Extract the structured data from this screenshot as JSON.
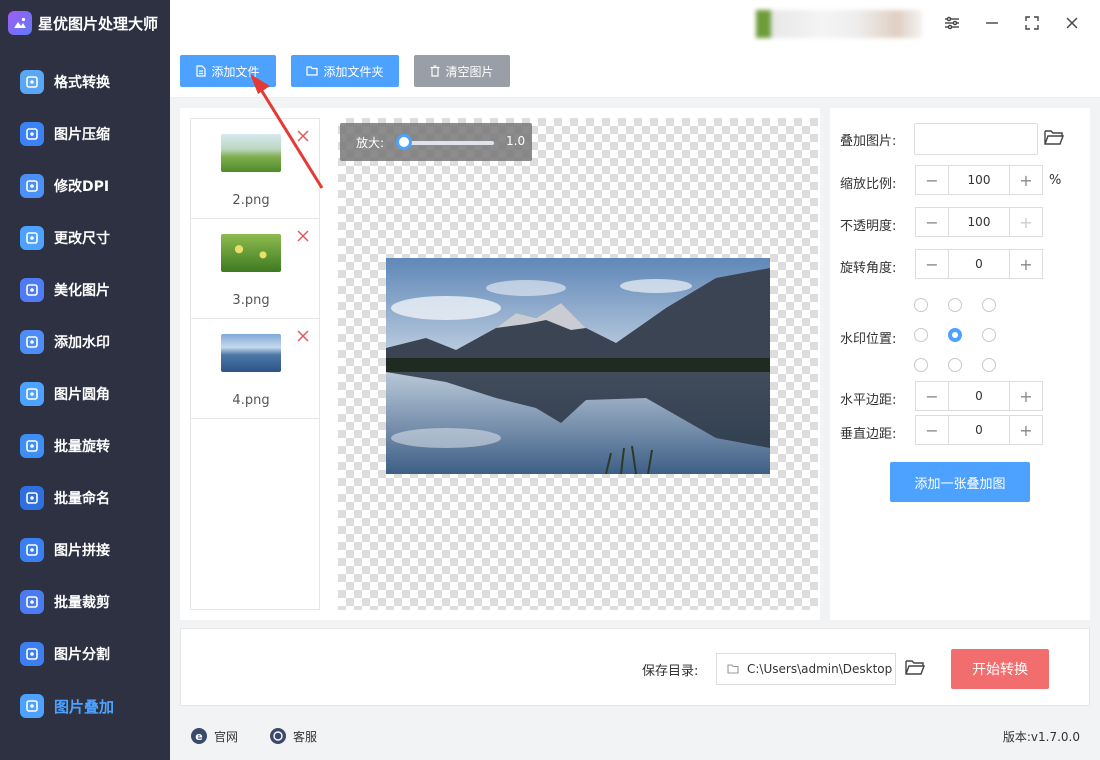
{
  "app": {
    "title": "星优图片处理大师"
  },
  "sidebar": {
    "items": [
      {
        "label": "格式转换",
        "icon": "image-convert-icon",
        "color": "#5aa7f5"
      },
      {
        "label": "图片压缩",
        "icon": "image-compress-icon",
        "color": "#3b82f6"
      },
      {
        "label": "修改DPI",
        "icon": "dpi-icon",
        "color": "#4c8ff5"
      },
      {
        "label": "更改尺寸",
        "icon": "resize-icon",
        "color": "#4ea2ff"
      },
      {
        "label": "美化图片",
        "icon": "beautify-icon",
        "color": "#4f7cf5"
      },
      {
        "label": "添加水印",
        "icon": "watermark-icon",
        "color": "#4e8df5"
      },
      {
        "label": "图片圆角",
        "icon": "round-corner-icon",
        "color": "#4ea2ff"
      },
      {
        "label": "批量旋转",
        "icon": "rotate-icon",
        "color": "#3d8ef5"
      },
      {
        "label": "批量命名",
        "icon": "rename-icon",
        "color": "#2f6fe0"
      },
      {
        "label": "图片拼接",
        "icon": "stitch-icon",
        "color": "#3a7ff0"
      },
      {
        "label": "批量裁剪",
        "icon": "crop-icon",
        "color": "#4a7cf0"
      },
      {
        "label": "图片分割",
        "icon": "split-icon",
        "color": "#3d7ef2"
      },
      {
        "label": "图片叠加",
        "icon": "overlay-layers-icon",
        "color": "#4ea2ff",
        "active": true
      }
    ]
  },
  "toolbar": {
    "add_file": "添加文件",
    "add_folder": "添加文件夹",
    "clear_images": "清空图片"
  },
  "files": [
    {
      "name": "2.png",
      "thumb": "meadow"
    },
    {
      "name": "3.png",
      "thumb": "flowers"
    },
    {
      "name": "4.png",
      "thumb": "mountains"
    }
  ],
  "zoom": {
    "label": "放大:",
    "value": "1.0",
    "level": 0.0
  },
  "settings": {
    "overlay_image_label": "叠加图片:",
    "scale_label": "缩放比例:",
    "scale_value": "100",
    "scale_unit": "%",
    "opacity_label": "不透明度:",
    "opacity_value": "100",
    "rotation_label": "旋转角度:",
    "rotation_value": "0",
    "position_label": "水印位置:",
    "position_selected": "center",
    "h_margin_label": "水平边距:",
    "h_margin_value": "0",
    "v_margin_label": "垂直边距:",
    "v_margin_value": "0",
    "add_overlay_button": "添加一张叠加图",
    "minus": "−",
    "plus": "+"
  },
  "output": {
    "save_dir_label": "保存目录:",
    "save_dir_value": "C:\\Users\\admin\\Desktop",
    "start_button": "开始转换"
  },
  "footer": {
    "website": "官网",
    "support": "客服",
    "version": "版本:v1.7.0.0"
  },
  "colors": {
    "accent": "#4ea2ff",
    "sidebar_bg": "#2d3142",
    "start_button": "#f26d6d",
    "annotation_arrow": "#e53935"
  }
}
